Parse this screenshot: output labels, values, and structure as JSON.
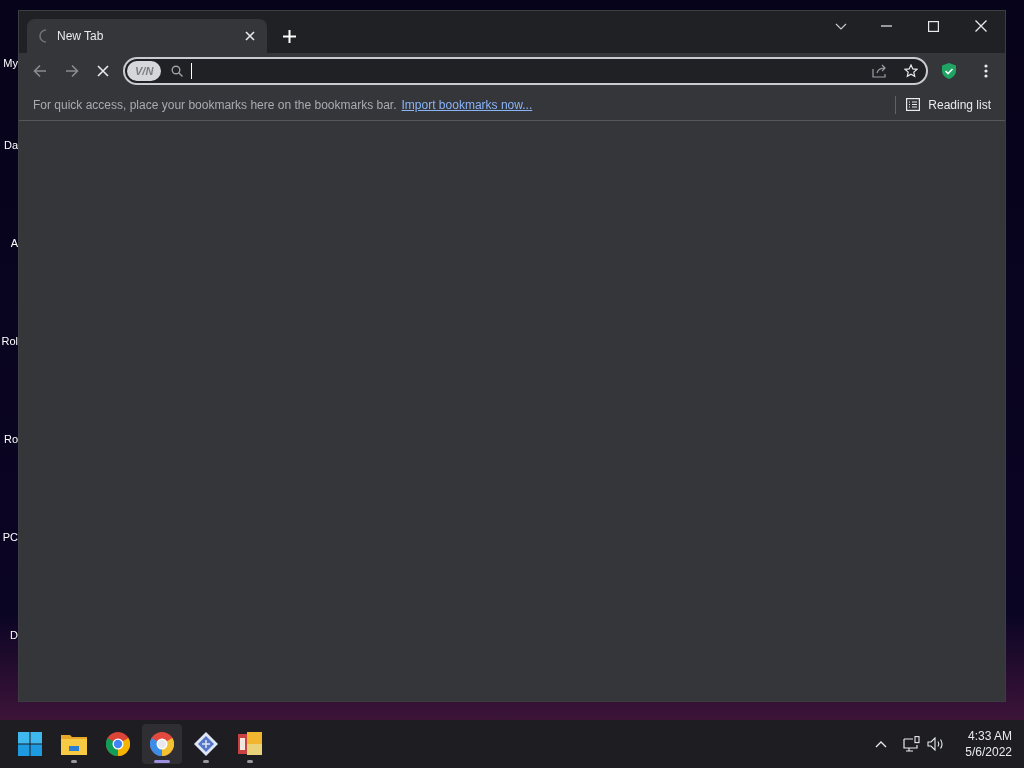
{
  "desktop": {
    "icons": [
      {
        "label": "My"
      },
      {
        "label": "Da"
      },
      {
        "label": "A"
      },
      {
        "label": "Rol"
      },
      {
        "label": "Ro"
      },
      {
        "label": "PC"
      },
      {
        "label": "D"
      }
    ]
  },
  "browser": {
    "tabs": [
      {
        "title": "New Tab",
        "loading": true,
        "selected": true
      }
    ],
    "address_bar": {
      "badge": "V/N"
    },
    "bookmarks_bar": {
      "hint": "For quick access, place your bookmarks here on the bookmarks bar.",
      "link": "Import bookmarks now...",
      "reading_list": "Reading list"
    }
  },
  "taskbar": {
    "apps": [
      {
        "kind": "start",
        "selected": false,
        "running": false
      },
      {
        "kind": "folder",
        "selected": false,
        "running": true
      },
      {
        "kind": "chrome",
        "selected": false,
        "running": false
      },
      {
        "kind": "chrome-alt",
        "selected": true,
        "running": true
      },
      {
        "kind": "diamond",
        "selected": false,
        "running": true
      },
      {
        "kind": "tiles",
        "selected": false,
        "running": true
      }
    ],
    "time": "4:33 AM",
    "date": "5/6/2022"
  }
}
